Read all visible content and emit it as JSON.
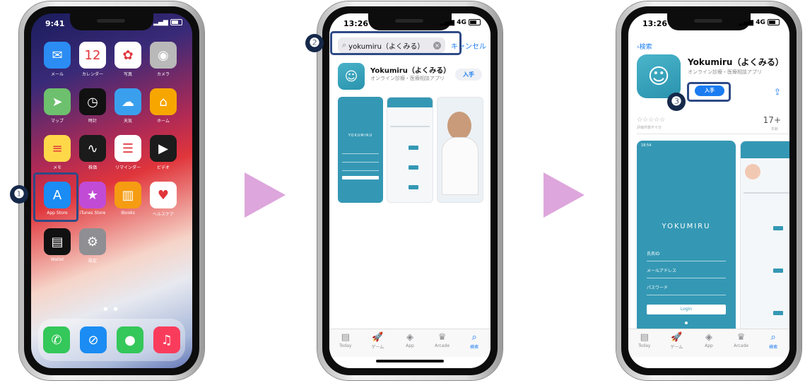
{
  "phone1": {
    "time": "9:41",
    "apps": [
      {
        "label": "メール",
        "icon": "mail-icon",
        "glyph": "✉",
        "color": "#2b8cf3"
      },
      {
        "label": "カレンダー",
        "icon": "calendar-icon",
        "glyph": "12",
        "color": "#ffffff"
      },
      {
        "label": "写真",
        "icon": "photos-icon",
        "glyph": "✿",
        "color": "#ffffff"
      },
      {
        "label": "カメラ",
        "icon": "camera-icon",
        "glyph": "◉",
        "color": "#b9b9b9"
      },
      {
        "label": "マップ",
        "icon": "maps-icon",
        "glyph": "➤",
        "color": "#6dc06d"
      },
      {
        "label": "時計",
        "icon": "clock-icon",
        "glyph": "◷",
        "color": "#111111"
      },
      {
        "label": "天気",
        "icon": "weather-icon",
        "glyph": "☁",
        "color": "#3aa0ee"
      },
      {
        "label": "ホーム",
        "icon": "home-app-icon",
        "glyph": "⌂",
        "color": "#f7a600"
      },
      {
        "label": "メモ",
        "icon": "notes-icon",
        "glyph": "≡",
        "color": "#ffd84a"
      },
      {
        "label": "株価",
        "icon": "stocks-icon",
        "glyph": "∿",
        "color": "#1b1b1b"
      },
      {
        "label": "リマインダー",
        "icon": "reminders-icon",
        "glyph": "☰",
        "color": "#ffffff"
      },
      {
        "label": "ビデオ",
        "icon": "tv-icon",
        "glyph": "▶",
        "color": "#1c1c1c"
      },
      {
        "label": "App Store",
        "icon": "app-store-icon",
        "glyph": "A",
        "color": "#1a8cf3"
      },
      {
        "label": "iTunes Store",
        "icon": "itunes-store-icon",
        "glyph": "★",
        "color": "#c24bd6"
      },
      {
        "label": "iBooks",
        "icon": "books-icon",
        "glyph": "▥",
        "color": "#f59c12"
      },
      {
        "label": "ヘルスケア",
        "icon": "health-icon",
        "glyph": "♥",
        "color": "#ffffff"
      },
      {
        "label": "Wallet",
        "icon": "wallet-icon",
        "glyph": "▤",
        "color": "#111111"
      },
      {
        "label": "設定",
        "icon": "settings-icon",
        "glyph": "⚙",
        "color": "#8e8e93"
      }
    ],
    "dock": [
      {
        "icon": "phone-icon",
        "glyph": "✆",
        "color": "#34c759"
      },
      {
        "icon": "safari-icon",
        "glyph": "⊘",
        "color": "#1a8cf3"
      },
      {
        "icon": "messages-icon",
        "glyph": "●",
        "color": "#34c759"
      },
      {
        "icon": "music-icon",
        "glyph": "♫",
        "color": "#fa3c5c"
      }
    ]
  },
  "phone2": {
    "time": "13:26",
    "network": "4G",
    "search_query": "yokumiru（よくみる）",
    "cancel_label": "キャンセル",
    "result": {
      "name": "Yokumiru（よくみる）",
      "subtitle": "オンライン診療・医療相談アプリ",
      "get_label": "入手"
    },
    "tabs": [
      {
        "label": "Today",
        "glyph": "▤",
        "icon": "today-tab-icon"
      },
      {
        "label": "ゲーム",
        "glyph": "🚀",
        "icon": "games-tab-icon"
      },
      {
        "label": "App",
        "glyph": "◈",
        "icon": "apps-tab-icon"
      },
      {
        "label": "Arcade",
        "glyph": "♛",
        "icon": "arcade-tab-icon"
      },
      {
        "label": "検索",
        "glyph": "⌕",
        "icon": "search-tab-icon"
      }
    ]
  },
  "phone3": {
    "time": "13:26",
    "network": "4G",
    "back_label": "検索",
    "name": "Yokumiru（よくみる）",
    "subtitle": "オンライン診療・医療相談アプリ",
    "get_label": "入手",
    "rating_stars": "☆☆☆☆☆",
    "rating_note": "評価件数不十分",
    "age": "17+",
    "age_label": "年齢",
    "screenshot": {
      "time": "18:54",
      "logo": "YOKUMIRU",
      "fields": [
        "氏名ID",
        "メールアドレス",
        "パスワード"
      ],
      "login": "Login"
    },
    "tabs": [
      {
        "label": "Today",
        "glyph": "▤",
        "icon": "today-tab-icon"
      },
      {
        "label": "ゲーム",
        "glyph": "🚀",
        "icon": "games-tab-icon"
      },
      {
        "label": "App",
        "glyph": "◈",
        "icon": "apps-tab-icon"
      },
      {
        "label": "Arcade",
        "glyph": "♛",
        "icon": "arcade-tab-icon"
      },
      {
        "label": "検索",
        "glyph": "⌕",
        "icon": "search-tab-icon"
      }
    ]
  },
  "steps": [
    "❶",
    "❷",
    "❸"
  ],
  "colors": {
    "accent": "#1a7cf0",
    "arrow": "#dda6dc",
    "badge": "#16294a",
    "highlight": "#2e4a86",
    "brand": "#3498b4"
  }
}
